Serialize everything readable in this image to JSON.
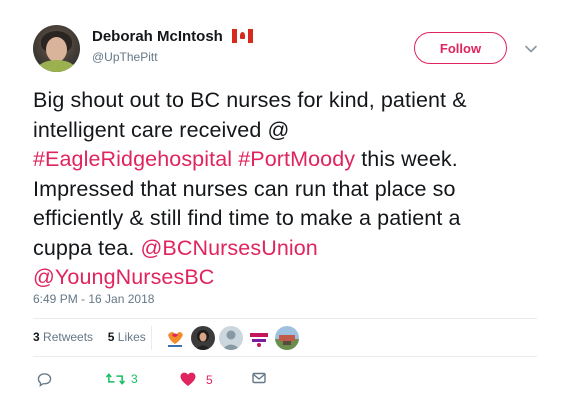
{
  "author": {
    "name": "Deborah McIntosh",
    "handle": "@UpThePitt",
    "flag_icon": "canada-flag-icon"
  },
  "follow": {
    "label": "Follow"
  },
  "menu": {
    "icon": "chevron-down-icon"
  },
  "tweet": {
    "line1": "Big shout out to BC nurses for kind, patient &",
    "line2": "intelligent care received @",
    "line3_link1": "#EagleRidgehospital",
    "line3_space": " ",
    "line3_link2": "#PortMoody",
    "line3_text": " this week.",
    "line4": "Impressed that nurses can run that place so",
    "line5": "efficiently & still find time to make a patient a",
    "line6_text": "cuppa tea. ",
    "line6_link": "@BCNursesUnion",
    "line7_link": "@YoungNursesBC"
  },
  "timestamp": "6:49 PM - 16 Jan 2018",
  "stats": {
    "retweets_count": "3",
    "retweets_label": "Retweets",
    "likes_count": "5",
    "likes_label": "Likes"
  },
  "actions": {
    "reply_icon": "reply-icon",
    "retweet_icon": "retweet-icon",
    "retweet_count": "3",
    "like_icon": "heart-icon",
    "like_count": "5",
    "dm_icon": "envelope-icon"
  },
  "colors": {
    "link": "#e0245e",
    "text": "#14171a",
    "muted": "#657786",
    "retweet": "#17bf63",
    "like": "#e0245e"
  }
}
